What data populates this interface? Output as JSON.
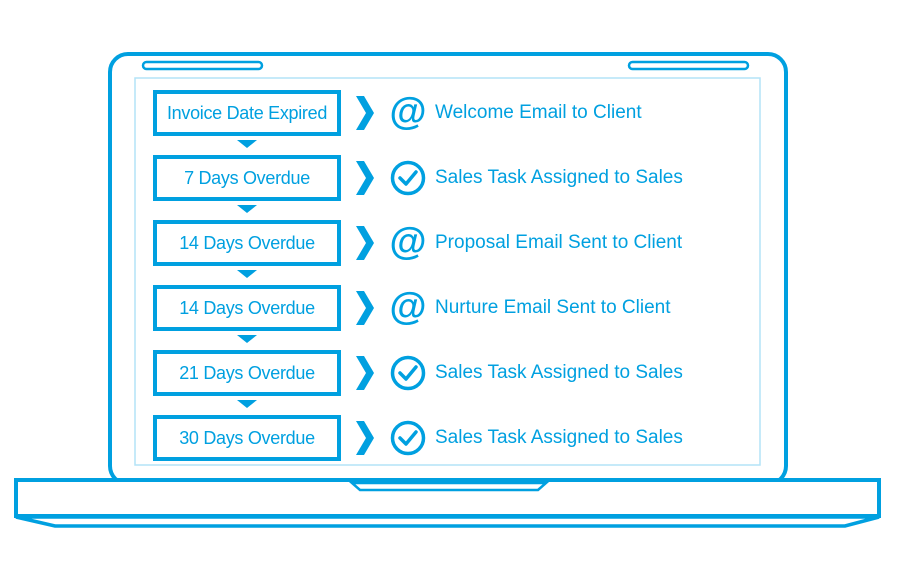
{
  "colors": {
    "accent": "#00a0e0",
    "screen_border": "#b3e3f7"
  },
  "rows": [
    {
      "trigger": "Invoice Date Expired",
      "icon": "at-icon",
      "action": "Welcome Email to Client"
    },
    {
      "trigger": "7 Days Overdue",
      "icon": "check-circle-icon",
      "action": "Sales Task Assigned to Sales"
    },
    {
      "trigger": "14 Days Overdue",
      "icon": "at-icon",
      "action": "Proposal Email Sent to Client"
    },
    {
      "trigger": "14 Days Overdue",
      "icon": "at-icon",
      "action": "Nurture Email Sent to Client"
    },
    {
      "trigger": "21 Days Overdue",
      "icon": "check-circle-icon",
      "action": "Sales Task Assigned to Sales"
    },
    {
      "trigger": "30 Days Overdue",
      "icon": "check-circle-icon",
      "action": "Sales Task Assigned to Sales"
    }
  ]
}
